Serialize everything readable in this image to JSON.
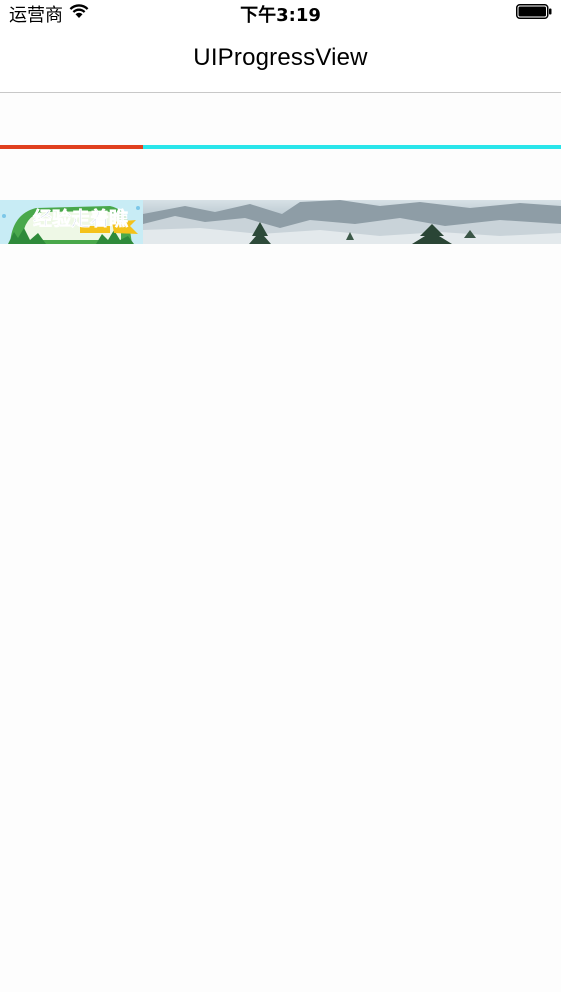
{
  "status_bar": {
    "carrier": "运营商",
    "time": "下午3:19",
    "wifi_icon": "wifi-icon",
    "battery_icon": "battery-icon"
  },
  "nav": {
    "title": "UIProgressView"
  },
  "progress": {
    "value": 0.255,
    "progress_tint": "#e0401f",
    "track_tint": "#29e5ea"
  },
  "image_progress": {
    "value": 0.255,
    "progress_image": "banner-image",
    "track_image": "mountain-landscape-image",
    "banner_text": "经验走着瞧"
  }
}
